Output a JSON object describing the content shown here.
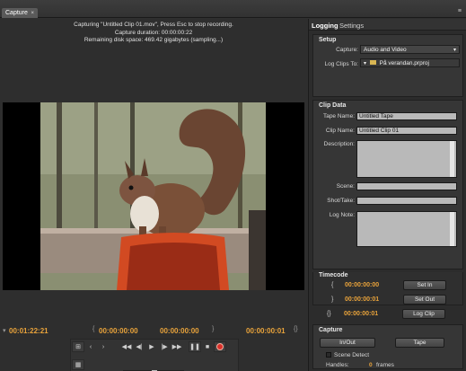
{
  "tab": {
    "label": "Capture",
    "close": "×"
  },
  "panel_menu": "≡",
  "status": {
    "line1": "Capturing \"Untitled Clip 01.mov\", Press Esc to stop recording.",
    "line2": "Capture duration: 00:00:00:22",
    "line3": "Remaining disk space: 469.42 gigabytes (sampling...)"
  },
  "timecodes": {
    "current": "00:01:22:21",
    "in": "00:00:00:00",
    "out": "00:00:00:00",
    "duration": "00:00:00:01"
  },
  "right_tabs": {
    "logging": "Logging",
    "settings": "Settings"
  },
  "setup": {
    "heading": "Setup",
    "capture_label": "Capture:",
    "capture_value": "Audio and Video",
    "log_clips_label": "Log Clips To:",
    "log_clips_value": "På verandan.prproj"
  },
  "clip_data": {
    "heading": "Clip Data",
    "tape_name_label": "Tape Name:",
    "tape_name_value": "Untitled Tape",
    "clip_name_label": "Clip Name:",
    "clip_name_value": "Untitled Clip 01",
    "description_label": "Description:",
    "scene_label": "Scene:",
    "shot_label": "Shot/Take:",
    "log_note_label": "Log Note:"
  },
  "timecode_section": {
    "heading": "Timecode",
    "in_value": "00:00:00:00",
    "out_value": "00:00:00:01",
    "dur_value": "00:00:00:01",
    "set_in": "Set In",
    "set_out": "Set Out",
    "log_clip": "Log Clip"
  },
  "capture_section": {
    "heading": "Capture",
    "in_out": "In/Out",
    "tape": "Tape",
    "scene_detect": "Scene Detect",
    "handles_label": "Handles:",
    "handles_value": "0",
    "handles_unit": "frames"
  },
  "colors": {
    "timecode": "#e9a33b",
    "record": "#d9302a"
  }
}
